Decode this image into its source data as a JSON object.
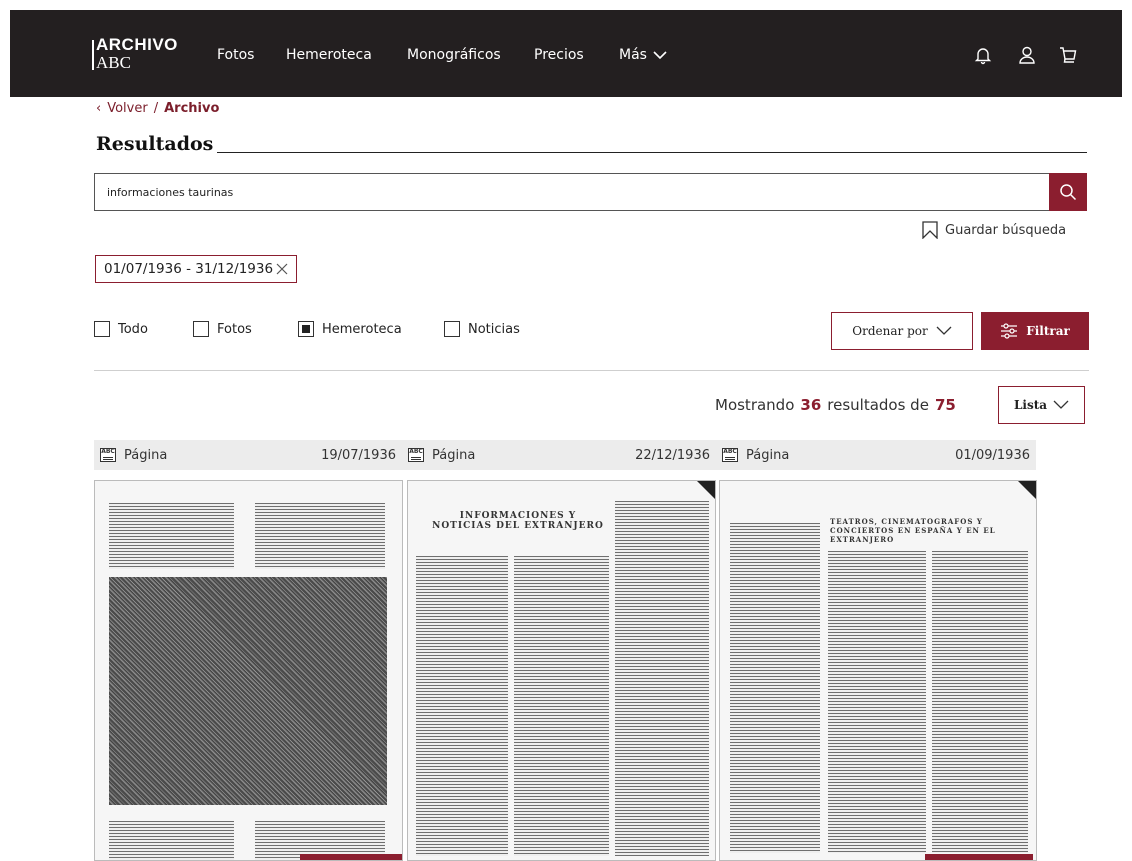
{
  "logo": {
    "line1": "ARCHIVO",
    "line2": "ABC"
  },
  "nav": {
    "fotos": "Fotos",
    "hemeroteca": "Hemeroteca",
    "monograficos": "Monográficos",
    "precios": "Precios",
    "mas": "Más"
  },
  "header_icons": [
    "bell-icon",
    "user-icon",
    "cart-icon"
  ],
  "breadcrumb": {
    "back": "Volver",
    "separator": "/",
    "current": "Archivo"
  },
  "results_title": "Resultados",
  "search": {
    "value": "informaciones taurinas"
  },
  "save_search_label": "Guardar búsqueda",
  "date_filter": {
    "label": "01/07/1936 - 31/12/1936"
  },
  "categories": [
    {
      "label": "Todo",
      "checked": false
    },
    {
      "label": "Fotos",
      "checked": false
    },
    {
      "label": "Hemeroteca",
      "checked": true
    },
    {
      "label": "Noticias",
      "checked": false
    }
  ],
  "order_label": "Ordenar por",
  "filter_label": "Filtrar",
  "showing": {
    "prefix": "Mostrando",
    "count": "36",
    "middle": "resultados de",
    "total": "75"
  },
  "view_label": "Lista",
  "results": [
    {
      "type": "Página",
      "date": "19/07/1936"
    },
    {
      "type": "Página",
      "date": "22/12/1936",
      "headline": "INFORMACIONES Y NOTICIAS DEL EXTRANJERO"
    },
    {
      "type": "Página",
      "date": "01/09/1936",
      "headline": "TEATROS, CINEMATOGRAFOS Y CONCIERTOS EN ESPAÑA Y EN EL EXTRANJERO"
    }
  ],
  "colors": {
    "brand": "#8b1e2f",
    "topbar": "#231f20"
  }
}
